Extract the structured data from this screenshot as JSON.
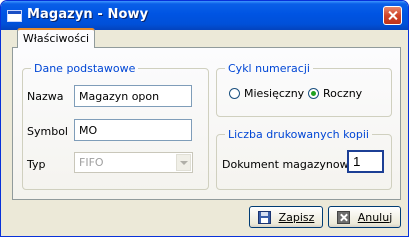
{
  "window": {
    "title": "Magazyn - Nowy"
  },
  "tabs": [
    {
      "label": "Właściwości",
      "active": true
    }
  ],
  "basic": {
    "legend": "Dane podstawowe",
    "name_label": "Nazwa",
    "name_value": "Magazyn opon",
    "symbol_label": "Symbol",
    "symbol_value": "MO",
    "type_label": "Typ",
    "type_value": "FIFO"
  },
  "numbering": {
    "legend": "Cykl numeracji",
    "monthly_label": "Miesięczny",
    "yearly_label": "Roczny",
    "selected": "yearly"
  },
  "copies": {
    "legend": "Liczba drukowanych kopii",
    "document_label": "Dokument magazynowy",
    "document_value": "1"
  },
  "buttons": {
    "save_label": "Zapisz",
    "cancel_label": "Anuluj"
  },
  "icons": {
    "app": "window-app-icon",
    "close": "close-icon",
    "save": "floppy-disk-icon",
    "cancel": "cancel-x-icon"
  }
}
